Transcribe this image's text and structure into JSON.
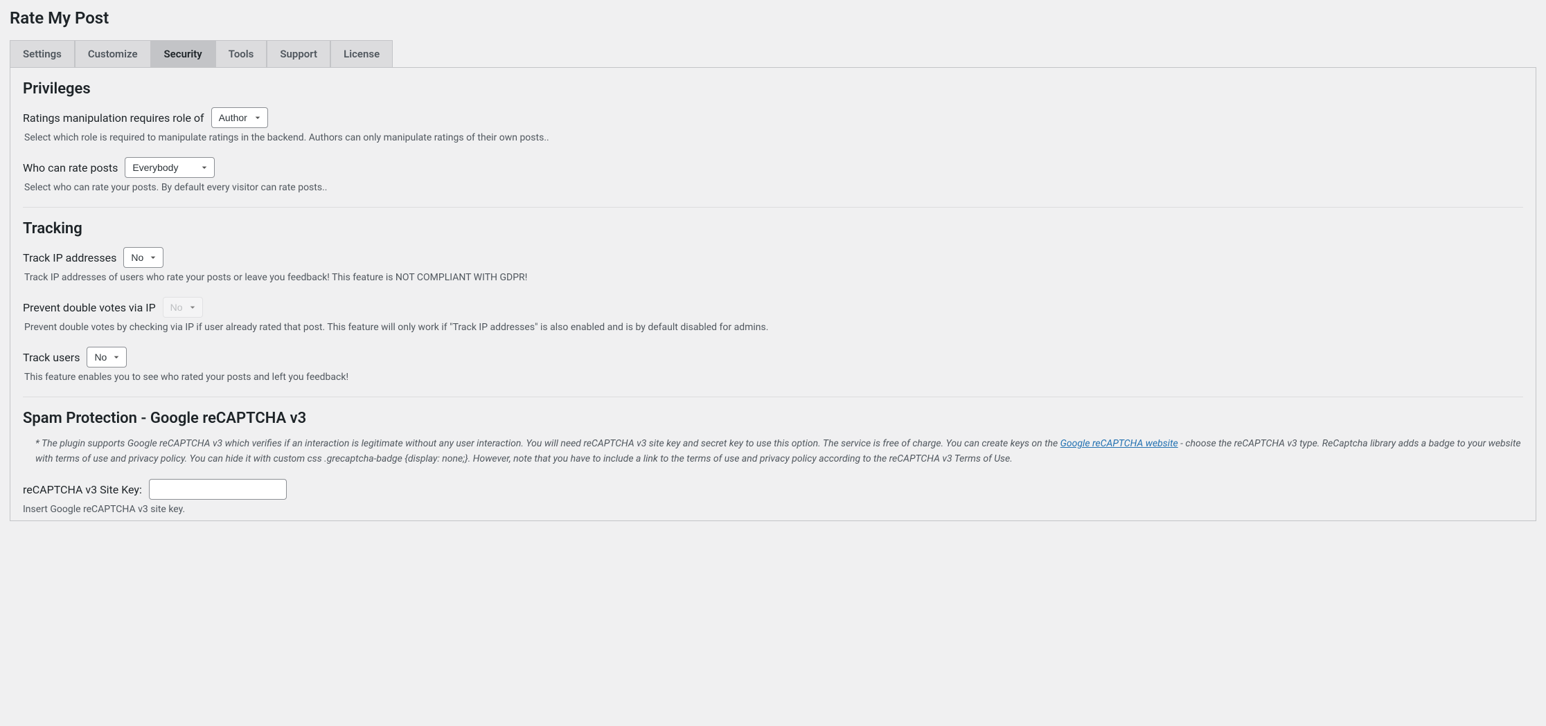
{
  "page_title": "Rate My Post",
  "tabs": [
    {
      "label": "Settings",
      "active": false
    },
    {
      "label": "Customize",
      "active": false
    },
    {
      "label": "Security",
      "active": true
    },
    {
      "label": "Tools",
      "active": false
    },
    {
      "label": "Support",
      "active": false
    },
    {
      "label": "License",
      "active": false
    }
  ],
  "sections": {
    "privileges": {
      "title": "Privileges",
      "role_label": "Ratings manipulation requires role of",
      "role_value": "Author",
      "role_desc": "Select which role is required to manipulate ratings in the backend. Authors can only manipulate ratings of their own posts..",
      "who_label": "Who can rate posts",
      "who_value": "Everybody",
      "who_desc": "Select who can rate your posts. By default every visitor can rate posts.."
    },
    "tracking": {
      "title": "Tracking",
      "ip_label": "Track IP addresses",
      "ip_value": "No",
      "ip_desc": "Track IP addresses of users who rate your posts or leave you feedback! This feature is NOT COMPLIANT WITH GDPR!",
      "prevent_label": "Prevent double votes via IP",
      "prevent_value": "No",
      "prevent_desc": "Prevent double votes by checking via IP if user already rated that post. This feature will only work if \"Track IP addresses\" is also enabled and is by default disabled for admins.",
      "users_label": "Track users",
      "users_value": "No",
      "users_desc": "This feature enables you to see who rated your posts and left you feedback!"
    },
    "spam": {
      "title": "Spam Protection - Google reCAPTCHA v3",
      "intro_before": "* The plugin supports Google reCAPTCHA v3 which verifies if an interaction is legitimate without any user interaction. You will need reCAPTCHA v3 site key and secret key to use this option. The service is free of charge. You can create keys on the ",
      "intro_link": "Google reCAPTCHA website",
      "intro_after": " - choose the reCAPTCHA v3 type. ReCaptcha library adds a badge to your website with terms of use and privacy policy. You can hide it with custom css .grecaptcha-badge {display: none;}. However, note that you have to include a link to the terms of use and privacy policy according to the reCAPTCHA v3 Terms of Use.",
      "sitekey_label": "reCAPTCHA v3 Site Key:",
      "sitekey_value": "",
      "sitekey_desc": "Insert Google reCAPTCHA v3 site key."
    }
  }
}
